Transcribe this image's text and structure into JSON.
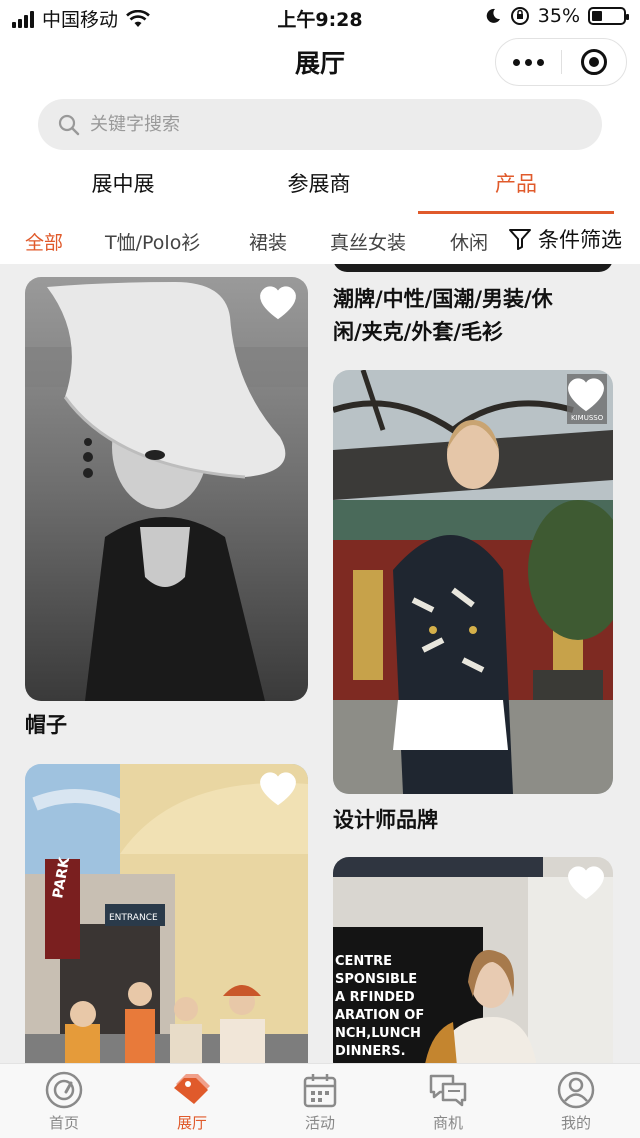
{
  "status": {
    "carrier": "中国移动",
    "time": "上午9:28",
    "battery": "35%"
  },
  "nav": {
    "title": "展厅"
  },
  "search": {
    "placeholder": "关键字搜索"
  },
  "main_tabs": [
    {
      "label": "展中展"
    },
    {
      "label": "参展商"
    },
    {
      "label": "产品"
    }
  ],
  "categories": [
    {
      "label": "全部"
    },
    {
      "label": "T恤/Polo衫"
    },
    {
      "label": "裙装"
    },
    {
      "label": "真丝女装"
    },
    {
      "label": "休闲"
    }
  ],
  "filter": {
    "label": "条件筛选"
  },
  "left_column": [
    {
      "title": "帽子"
    },
    {
      "title": ""
    }
  ],
  "right_column": [
    {
      "title_line1": "潮牌/中性/国潮/男装/休",
      "title_line2": "闲/夹克/外套/毛衫"
    },
    {
      "title": "设计师品牌",
      "watermark": "KIMUSSO"
    },
    {
      "sign_lines": [
        "CENTRE",
        "SPONSIBLE",
        "A RFINDED",
        "ARATION OF",
        "NCH,LUNCH",
        "DINNERS."
      ]
    }
  ],
  "park_sign": {
    "park": "PARK",
    "entrance": "ENTRANCE"
  },
  "tabbar": [
    {
      "label": "首页",
      "icon": "compass-icon"
    },
    {
      "label": "展厅",
      "icon": "tag-icon"
    },
    {
      "label": "活动",
      "icon": "calendar-icon"
    },
    {
      "label": "商机",
      "icon": "chat-icon"
    },
    {
      "label": "我的",
      "icon": "user-icon"
    }
  ],
  "colors": {
    "accent": "#e05a2b",
    "background": "#eeeeee"
  }
}
